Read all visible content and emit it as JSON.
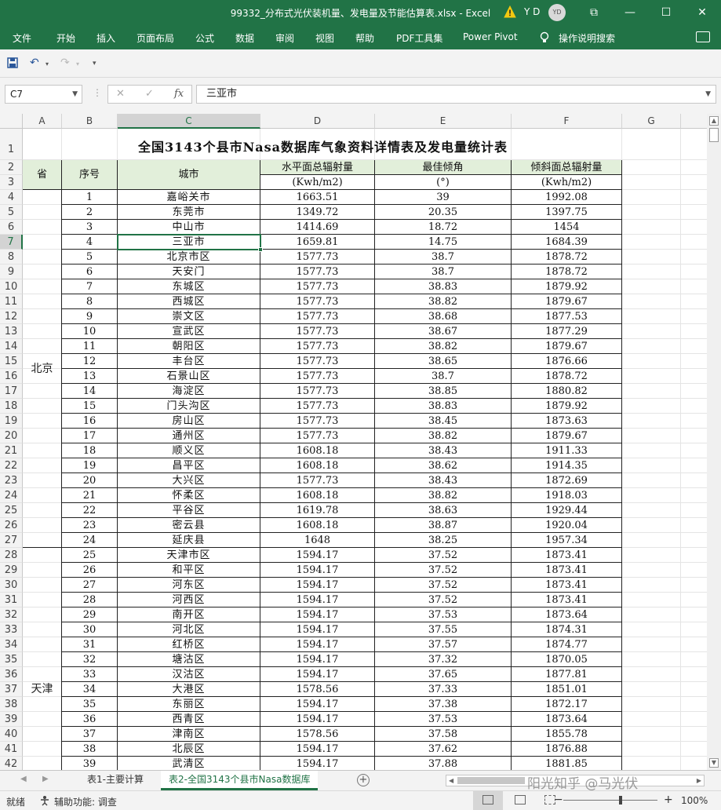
{
  "window": {
    "title": "99332_分布式光伏装机量、发电量及节能估算表.xlsx  -  Excel",
    "user_initials": "Y D",
    "avatar_text": "YD",
    "buttons": {
      "ribbon_display": "⧉",
      "minimize": "—",
      "maximize": "☐",
      "close": "✕"
    }
  },
  "menu": {
    "tabs": [
      "文件",
      "开始",
      "插入",
      "页面布局",
      "公式",
      "数据",
      "审阅",
      "视图",
      "帮助",
      "PDF工具集",
      "Power Pivot",
      "操作说明搜索"
    ]
  },
  "qat": {
    "save": "💾",
    "undo": "↶",
    "redo": "↷",
    "customize": "▾"
  },
  "formula_bar": {
    "name_box": "C7",
    "cancel": "✕",
    "confirm": "✓",
    "fx": "fx",
    "value": "三亚市"
  },
  "columns": [
    "A",
    "B",
    "C",
    "D",
    "E",
    "F",
    "G"
  ],
  "selected_cell": {
    "column": "C",
    "row": "7"
  },
  "sheet": {
    "title": "全国3143个县市Nasa数据库气象资料详情表及发电量统计表",
    "headers": {
      "province": "省",
      "seq": "序号",
      "city": "城市",
      "horizontal": "水平面总辐射量",
      "angle": "最佳倾角",
      "tilted": "倾斜面总辐射量",
      "unit_horizontal": "(Kwh/m2)",
      "unit_angle": "(°)",
      "unit_tilted": "(Kwh/m2)"
    },
    "provinces": [
      {
        "name": "北京"
      },
      {
        "name": "天津"
      }
    ],
    "rows": [
      {
        "row": "4",
        "seq": "1",
        "city": "嘉峪关市",
        "h": "1663.51",
        "a": "39",
        "t": "1992.08"
      },
      {
        "row": "5",
        "seq": "2",
        "city": "东莞市",
        "h": "1349.72",
        "a": "20.35",
        "t": "1397.75"
      },
      {
        "row": "6",
        "seq": "3",
        "city": "中山市",
        "h": "1414.69",
        "a": "18.72",
        "t": "1454"
      },
      {
        "row": "7",
        "seq": "4",
        "city": "三亚市",
        "h": "1659.81",
        "a": "14.75",
        "t": "1684.39"
      },
      {
        "row": "8",
        "seq": "5",
        "city": "北京市区",
        "h": "1577.73",
        "a": "38.7",
        "t": "1878.72"
      },
      {
        "row": "9",
        "seq": "6",
        "city": "天安门",
        "h": "1577.73",
        "a": "38.7",
        "t": "1878.72"
      },
      {
        "row": "10",
        "seq": "7",
        "city": "东城区",
        "h": "1577.73",
        "a": "38.83",
        "t": "1879.92"
      },
      {
        "row": "11",
        "seq": "8",
        "city": "西城区",
        "h": "1577.73",
        "a": "38.82",
        "t": "1879.67"
      },
      {
        "row": "12",
        "seq": "9",
        "city": "崇文区",
        "h": "1577.73",
        "a": "38.68",
        "t": "1877.53"
      },
      {
        "row": "13",
        "seq": "10",
        "city": "宣武区",
        "h": "1577.73",
        "a": "38.67",
        "t": "1877.29"
      },
      {
        "row": "14",
        "seq": "11",
        "city": "朝阳区",
        "h": "1577.73",
        "a": "38.82",
        "t": "1879.67"
      },
      {
        "row": "15",
        "seq": "12",
        "city": "丰台区",
        "h": "1577.73",
        "a": "38.65",
        "t": "1876.66"
      },
      {
        "row": "16",
        "seq": "13",
        "city": "石景山区",
        "h": "1577.73",
        "a": "38.7",
        "t": "1878.72"
      },
      {
        "row": "17",
        "seq": "14",
        "city": "海淀区",
        "h": "1577.73",
        "a": "38.85",
        "t": "1880.82"
      },
      {
        "row": "18",
        "seq": "15",
        "city": "门头沟区",
        "h": "1577.73",
        "a": "38.83",
        "t": "1879.92"
      },
      {
        "row": "19",
        "seq": "16",
        "city": "房山区",
        "h": "1577.73",
        "a": "38.45",
        "t": "1873.63"
      },
      {
        "row": "20",
        "seq": "17",
        "city": "通州区",
        "h": "1577.73",
        "a": "38.82",
        "t": "1879.67"
      },
      {
        "row": "21",
        "seq": "18",
        "city": "顺义区",
        "h": "1608.18",
        "a": "38.43",
        "t": "1911.33"
      },
      {
        "row": "22",
        "seq": "19",
        "city": "昌平区",
        "h": "1608.18",
        "a": "38.62",
        "t": "1914.35"
      },
      {
        "row": "23",
        "seq": "20",
        "city": "大兴区",
        "h": "1577.73",
        "a": "38.43",
        "t": "1872.69"
      },
      {
        "row": "24",
        "seq": "21",
        "city": "怀柔区",
        "h": "1608.18",
        "a": "38.82",
        "t": "1918.03"
      },
      {
        "row": "25",
        "seq": "22",
        "city": "平谷区",
        "h": "1619.78",
        "a": "38.63",
        "t": "1929.44"
      },
      {
        "row": "26",
        "seq": "23",
        "city": "密云县",
        "h": "1608.18",
        "a": "38.87",
        "t": "1920.04"
      },
      {
        "row": "27",
        "seq": "24",
        "city": "延庆县",
        "h": "1648",
        "a": "38.25",
        "t": "1957.34"
      },
      {
        "row": "28",
        "seq": "25",
        "city": "天津市区",
        "h": "1594.17",
        "a": "37.52",
        "t": "1873.41"
      },
      {
        "row": "29",
        "seq": "26",
        "city": "和平区",
        "h": "1594.17",
        "a": "37.52",
        "t": "1873.41"
      },
      {
        "row": "30",
        "seq": "27",
        "city": "河东区",
        "h": "1594.17",
        "a": "37.52",
        "t": "1873.41"
      },
      {
        "row": "31",
        "seq": "28",
        "city": "河西区",
        "h": "1594.17",
        "a": "37.52",
        "t": "1873.41"
      },
      {
        "row": "32",
        "seq": "29",
        "city": "南开区",
        "h": "1594.17",
        "a": "37.53",
        "t": "1873.64"
      },
      {
        "row": "33",
        "seq": "30",
        "city": "河北区",
        "h": "1594.17",
        "a": "37.55",
        "t": "1874.31"
      },
      {
        "row": "34",
        "seq": "31",
        "city": "红桥区",
        "h": "1594.17",
        "a": "37.57",
        "t": "1874.77"
      },
      {
        "row": "35",
        "seq": "32",
        "city": "塘沽区",
        "h": "1594.17",
        "a": "37.32",
        "t": "1870.05"
      },
      {
        "row": "36",
        "seq": "33",
        "city": "汉沽区",
        "h": "1594.17",
        "a": "37.65",
        "t": "1877.81"
      },
      {
        "row": "37",
        "seq": "34",
        "city": "大港区",
        "h": "1578.56",
        "a": "37.33",
        "t": "1851.01"
      },
      {
        "row": "38",
        "seq": "35",
        "city": "东丽区",
        "h": "1594.17",
        "a": "37.38",
        "t": "1872.17"
      },
      {
        "row": "39",
        "seq": "36",
        "city": "西青区",
        "h": "1594.17",
        "a": "37.53",
        "t": "1873.64"
      },
      {
        "row": "40",
        "seq": "37",
        "city": "津南区",
        "h": "1578.56",
        "a": "37.58",
        "t": "1855.78"
      },
      {
        "row": "41",
        "seq": "38",
        "city": "北辰区",
        "h": "1594.17",
        "a": "37.62",
        "t": "1876.88"
      },
      {
        "row": "42",
        "seq": "39",
        "city": "武清区",
        "h": "1594.17",
        "a": "37.88",
        "t": "1881.85"
      }
    ]
  },
  "sheet_tabs": {
    "tabs": [
      "表1-主要计算",
      "表2-全国3143个县市Nasa数据库"
    ],
    "active_index": 1,
    "add": "+",
    "nav_prev": "◀",
    "nav_next": "▶"
  },
  "watermark": "阳光知乎 @马光伏",
  "status": {
    "ready": "就绪",
    "accessibility": "辅助功能: 调查",
    "zoom_minus": "−",
    "zoom_plus": "+",
    "zoom": "100%"
  },
  "colors": {
    "accent": "#217346",
    "header_fill": "#e2efda"
  }
}
